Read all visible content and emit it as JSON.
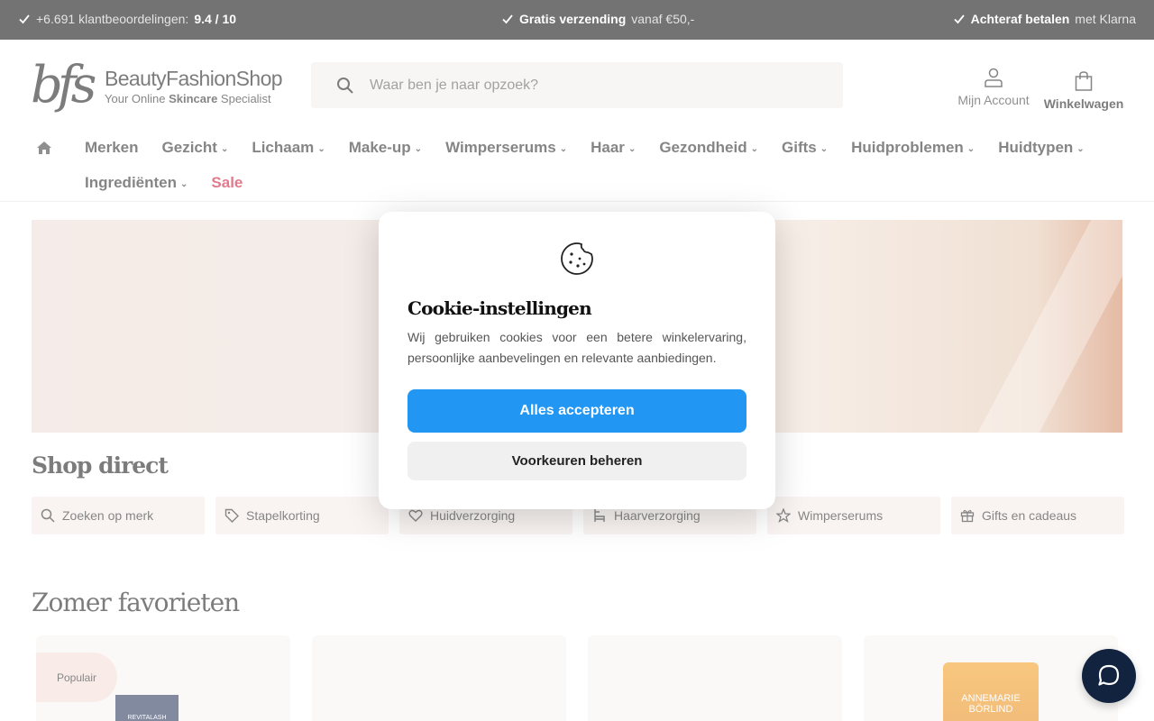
{
  "topbar": {
    "usp1": {
      "text": "+6.691 klantbeoordelingen:",
      "bold": "9.4 / 10"
    },
    "usp2": {
      "bold": "Gratis verzending",
      "text": "vanaf €50,-"
    },
    "usp3": {
      "bold": "Achteraf betalen",
      "text": "met Klarna"
    }
  },
  "header": {
    "logo": {
      "mark": "bfs",
      "name": "BeautyFashionShop",
      "tag_pre": "Your Online",
      "tag_bold": "Skincare",
      "tag_post": "Specialist"
    },
    "search": {
      "placeholder": "Waar ben je naar opzoek?"
    },
    "account_label": "Mijn Account",
    "cart_label": "Winkelwagen"
  },
  "nav": {
    "row1": [
      {
        "label": "Merken"
      },
      {
        "label": "Gezicht",
        "chevron": "⌄"
      },
      {
        "label": "Lichaam",
        "chevron": "⌄"
      },
      {
        "label": "Make-up",
        "chevron": "⌄"
      },
      {
        "label": "Wimperserums",
        "chevron": "⌄"
      },
      {
        "label": "Haar",
        "chevron": "⌄"
      },
      {
        "label": "Gezondheid",
        "chevron": "⌄"
      },
      {
        "label": "Gifts",
        "chevron": "⌄"
      },
      {
        "label": "Huidproblemen",
        "chevron": "⌄"
      },
      {
        "label": "Huidtypen",
        "chevron": "⌄"
      }
    ],
    "row2": [
      {
        "label": "Ingrediënten",
        "chevron": "⌄"
      },
      {
        "label": "Sale"
      }
    ]
  },
  "shop_direct": {
    "title": "Shop direct",
    "chips": [
      {
        "label": "Zoeken op merk",
        "icon": "search-icon"
      },
      {
        "label": "Stapelkorting",
        "icon": "tag-icon"
      },
      {
        "label": "Huidverzorging",
        "icon": "heart-icon"
      },
      {
        "label": "Haarverzorging",
        "icon": "chair-icon"
      },
      {
        "label": "Wimperserums",
        "icon": "star-icon"
      },
      {
        "label": "Gifts en cadeaus",
        "icon": "gift-icon"
      }
    ]
  },
  "zomer": {
    "title": "Zomer favorieten",
    "badge": "Populair",
    "product1_label": "REVITALASH",
    "product4_label_1": "ANNEMARIE",
    "product4_label_2": "BÖRLIND"
  },
  "cookie_modal": {
    "icon": "cookie-icon",
    "title": "Cookie-instellingen",
    "text": "Wij gebruiken cookies voor een betere winkelervaring, persoonlijke aanbevelingen en relevante aanbiedingen.",
    "accept_label": "Alles accepteren",
    "prefs_label": "Voorkeuren beheren"
  },
  "colors": {
    "accent": "#2196f3",
    "sale": "#c8102e",
    "chat": "#122340",
    "topbar": "#000000"
  }
}
